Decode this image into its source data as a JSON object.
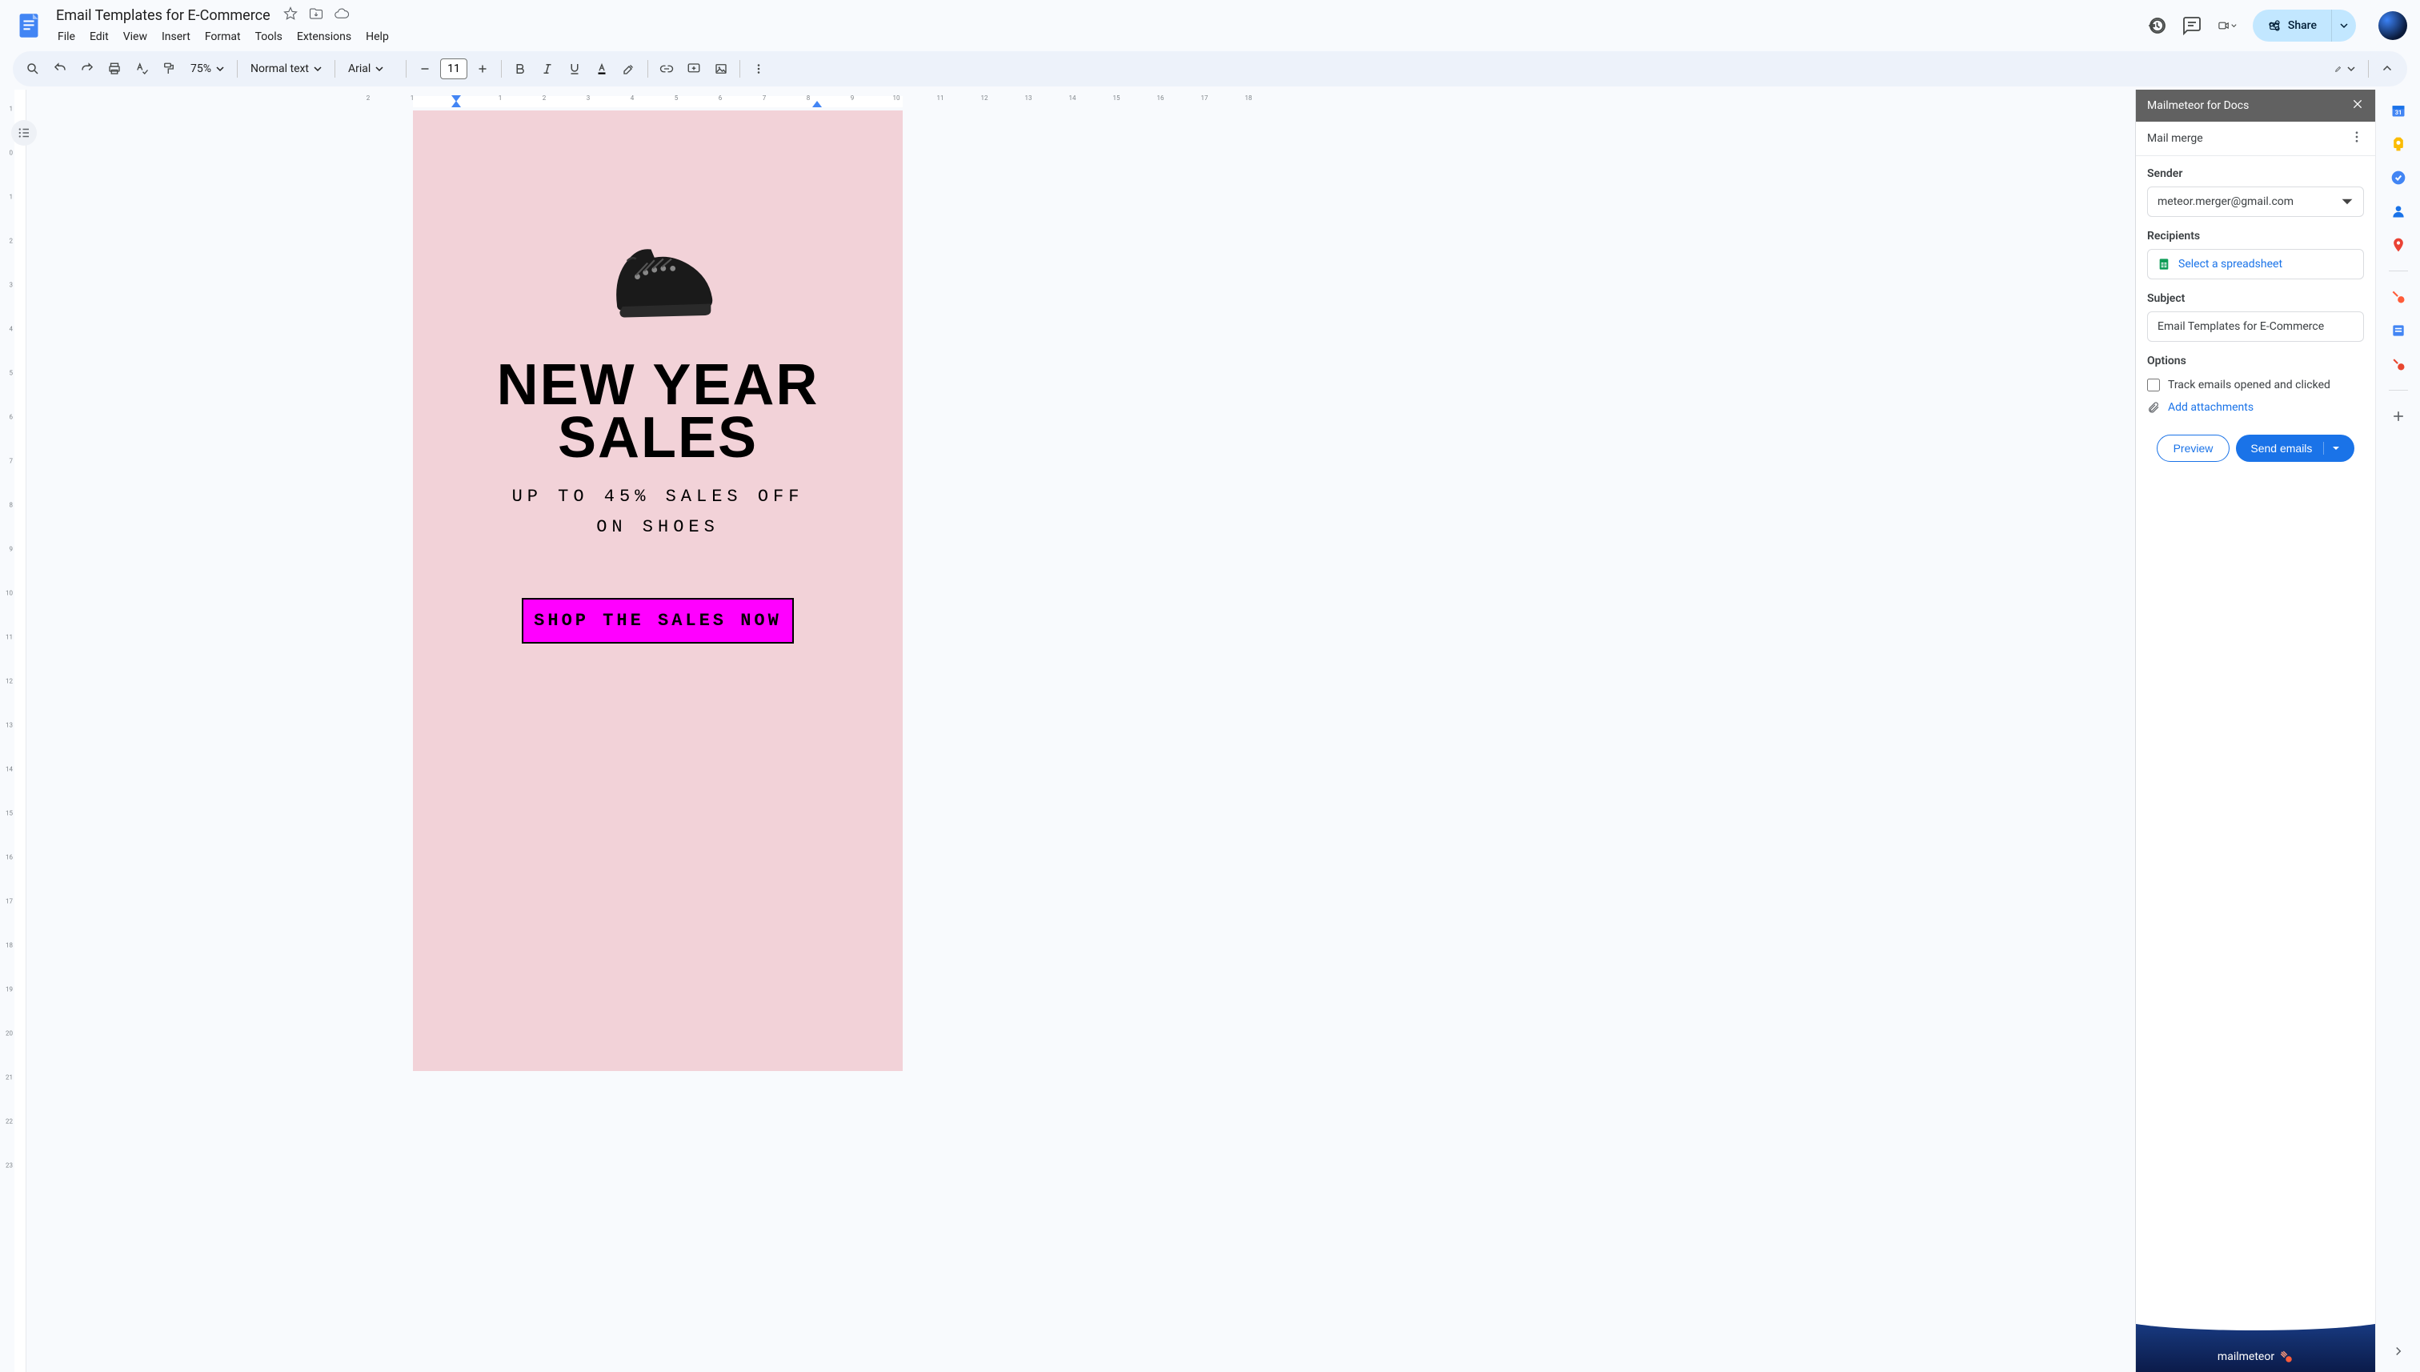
{
  "header": {
    "doc_title": "Email Templates for E-Commerce",
    "menu": [
      "File",
      "Edit",
      "View",
      "Insert",
      "Format",
      "Tools",
      "Extensions",
      "Help"
    ],
    "share_label": "Share"
  },
  "toolbar": {
    "zoom": "75%",
    "style": "Normal text",
    "font": "Arial",
    "font_size": "11"
  },
  "ruler": {
    "horiz_start": -2,
    "horiz_end": 18,
    "vert_start": -1,
    "vert_end": 23
  },
  "document": {
    "headline_1": "NEW YEAR",
    "headline_2": "SALES",
    "subline_1": "UP TO 45% SALES OFF",
    "subline_2": "ON SHOES",
    "cta": "SHOP THE SALES NOW"
  },
  "addon": {
    "title": "Mailmeteor for Docs",
    "subtitle": "Mail merge",
    "sender_label": "Sender",
    "sender_value": "meteor.merger@gmail.com",
    "recipients_label": "Recipients",
    "recipients_action": "Select a spreadsheet",
    "subject_label": "Subject",
    "subject_value": "Email Templates for E-Commerce",
    "options_label": "Options",
    "opt_track": "Track emails opened and clicked",
    "opt_attach": "Add attachments",
    "preview": "Preview",
    "send": "Send emails",
    "footer_brand": "mailmeteor"
  }
}
